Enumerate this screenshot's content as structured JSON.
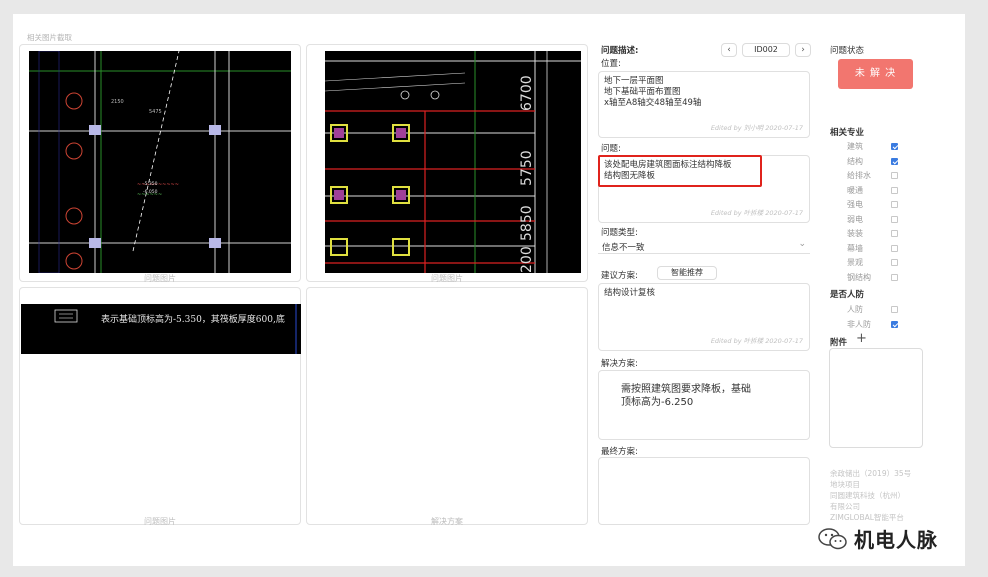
{
  "images": {
    "header": "相关图片截取",
    "slot1_caption": "问题图片",
    "slot2_caption": "问题图片",
    "slot3_caption": "问题图片",
    "slot4_caption": "解决方案",
    "banner_text": "表示基础顶标高为-5.350，其筏板厚度600,底"
  },
  "cad": {
    "dims": [
      "6700",
      "5750",
      "5850",
      "200"
    ],
    "note1": "2150",
    "note2": "5475",
    "note3": "-5.350",
    "note4": "-6.050"
  },
  "issue": {
    "desc_label": "问题描述:",
    "id": "ID002",
    "prev": "‹",
    "next": "›",
    "location_label": "位置:",
    "location_lines": [
      "地下一层平面图",
      "地下基础平面布置图",
      "x轴至A8轴交48轴至49轴"
    ],
    "location_edited": "Edited by 刘小明 2020-07-17",
    "problem_label": "问题:",
    "problem_lines": [
      "该处配电房建筑图面标注结构降板",
      "结构图无降板"
    ],
    "problem_edited": "Edited by 叶拆楼 2020-07-17",
    "type_label": "问题类型:",
    "type_value": "信息不一致",
    "suggest_label": "建议方案:",
    "smart_button": "智能推荐",
    "suggest_value": "结构设计复核",
    "suggest_edited": "Edited by 叶拆楼 2020-07-17",
    "solution_label": "解决方案:",
    "solution_lines": [
      "需按照建筑图要求降板，基础",
      "顶标高为-6.250"
    ],
    "final_label": "最终方案:"
  },
  "status": {
    "label": "问题状态",
    "button": "未 解 决",
    "color": "#f2766f"
  },
  "disciplines": {
    "label": "相关专业",
    "items": [
      {
        "name": "建筑",
        "checked": true
      },
      {
        "name": "结构",
        "checked": true
      },
      {
        "name": "给排水",
        "checked": false
      },
      {
        "name": "暖通",
        "checked": false
      },
      {
        "name": "强电",
        "checked": false
      },
      {
        "name": "弱电",
        "checked": false
      },
      {
        "name": "装装",
        "checked": false
      },
      {
        "name": "幕墙",
        "checked": false
      },
      {
        "name": "景观",
        "checked": false
      },
      {
        "name": "钢结构",
        "checked": false
      }
    ]
  },
  "defense": {
    "label": "是否人防",
    "items": [
      {
        "name": "人防",
        "checked": false
      },
      {
        "name": "非人防",
        "checked": true
      }
    ]
  },
  "attachment": {
    "label": "附件",
    "add": "+"
  },
  "footer": {
    "lines": [
      "余政储出（2019）35号",
      "地块项目",
      "同圆建筑科技（杭州）",
      "有限公司",
      "ZIMGLOBAL智能平台"
    ]
  },
  "watermark": {
    "text": "机电人脉"
  }
}
